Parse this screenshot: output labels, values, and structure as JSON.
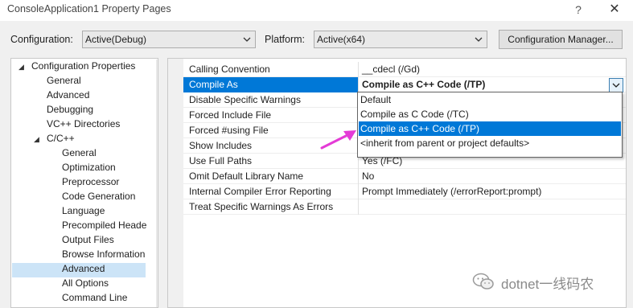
{
  "window": {
    "title": "ConsoleApplication1 Property Pages",
    "help": "?",
    "close": "✕"
  },
  "toolbar": {
    "configuration_label": "Configuration:",
    "configuration_value": "Active(Debug)",
    "platform_label": "Platform:",
    "platform_value": "Active(x64)",
    "config_manager_label": "Configuration Manager..."
  },
  "tree": {
    "items": [
      {
        "label": "Configuration Properties",
        "expander": "◢"
      },
      {
        "label": "General"
      },
      {
        "label": "Advanced"
      },
      {
        "label": "Debugging"
      },
      {
        "label": "VC++ Directories"
      },
      {
        "label": "C/C++",
        "expander": "◢"
      },
      {
        "label": "General"
      },
      {
        "label": "Optimization"
      },
      {
        "label": "Preprocessor"
      },
      {
        "label": "Code Generation"
      },
      {
        "label": "Language"
      },
      {
        "label": "Precompiled Heade"
      },
      {
        "label": "Output Files"
      },
      {
        "label": "Browse Information"
      },
      {
        "label": "Advanced",
        "selected": true
      },
      {
        "label": "All Options"
      },
      {
        "label": "Command Line"
      }
    ]
  },
  "grid": {
    "rows": [
      {
        "name": "Calling Convention",
        "value": "__cdecl (/Gd)"
      },
      {
        "name": "Compile As",
        "value": "Compile as C++ Code (/TP)",
        "selected": true
      },
      {
        "name": "Disable Specific Warnings",
        "value": ""
      },
      {
        "name": "Forced Include File",
        "value": ""
      },
      {
        "name": "Forced #using File",
        "value": ""
      },
      {
        "name": "Show Includes",
        "value": ""
      },
      {
        "name": "Use Full Paths",
        "value": "Yes (/FC)"
      },
      {
        "name": "Omit Default Library Name",
        "value": "No"
      },
      {
        "name": "Internal Compiler Error Reporting",
        "value": "Prompt Immediately (/errorReport:prompt)"
      },
      {
        "name": "Treat Specific Warnings As Errors",
        "value": ""
      }
    ]
  },
  "dropdown": {
    "options": [
      {
        "label": "Default"
      },
      {
        "label": "Compile as C Code (/TC)"
      },
      {
        "label": "Compile as C++ Code (/TP)",
        "selected": true
      },
      {
        "label": "<inherit from parent or project defaults>"
      }
    ]
  },
  "watermark": {
    "text": "dotnet一线码农"
  },
  "colors": {
    "accent": "#0078d7",
    "tree_selection": "#cce4f7",
    "annotation_arrow": "#e43bd6"
  },
  "icons": {
    "combo_arrow": "chevron-down-icon",
    "expander": "triangle-expander-icon",
    "watermark": "wechat-icon"
  }
}
